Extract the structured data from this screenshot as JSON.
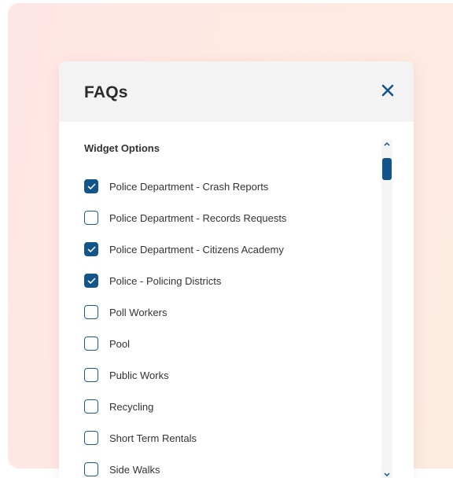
{
  "modal": {
    "title": "FAQs",
    "close_icon": "close-x-icon"
  },
  "widget_options": {
    "label": "Widget Options",
    "items": [
      {
        "label": "Police Department - Crash Reports",
        "checked": true
      },
      {
        "label": "Police Department - Records Requests",
        "checked": false
      },
      {
        "label": "Police Department - Citizens Academy",
        "checked": true
      },
      {
        "label": "Police - Policing Districts",
        "checked": true
      },
      {
        "label": "Poll Workers",
        "checked": false
      },
      {
        "label": "Pool",
        "checked": false
      },
      {
        "label": "Public Works",
        "checked": false
      },
      {
        "label": "Recycling",
        "checked": false
      },
      {
        "label": "Short Term Rentals",
        "checked": false
      },
      {
        "label": "Side Walks",
        "checked": false
      }
    ]
  },
  "scrollbar": {
    "up_icon": "chevron-up-icon",
    "down_icon": "chevron-down-icon",
    "position": 0.0
  },
  "colors": {
    "accent": "#12558a",
    "header_bg": "#f3f3f3",
    "backdrop": "#ffe8e3"
  }
}
